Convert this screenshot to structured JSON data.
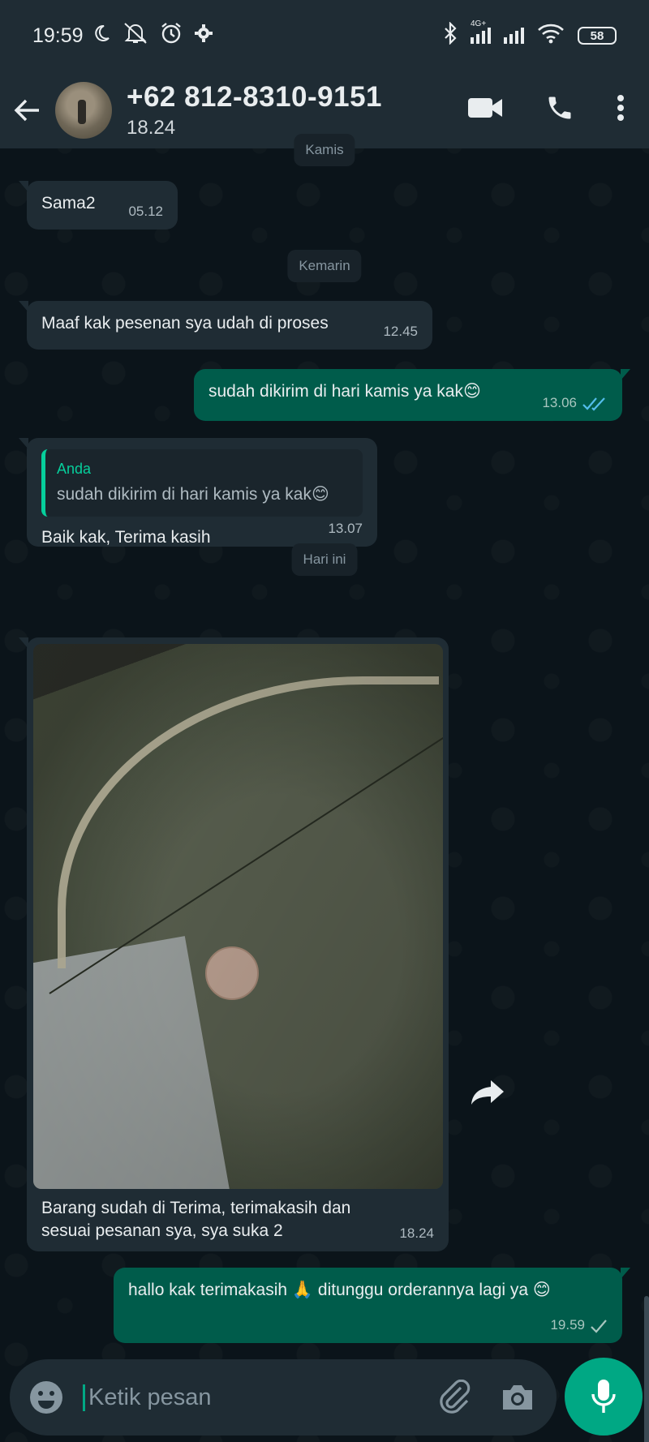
{
  "status": {
    "time": "19:59",
    "network": "4G+",
    "battery": "58"
  },
  "header": {
    "contact_name": "+62 812-8310-9151",
    "subtitle": "18.24"
  },
  "chat": {
    "dates": [
      "Kamis",
      "Kemarin",
      "Hari ini"
    ],
    "messages": [
      {
        "text": "Sama2",
        "time": "05.12"
      },
      {
        "text": "Maaf kak pesenan sya udah di proses",
        "time": "12.45"
      },
      {
        "text": "sudah dikirim di hari kamis ya kak😊",
        "time": "13.06"
      },
      {
        "quote_name": "Anda",
        "quote_text": "sudah dikirim di hari kamis ya kak😊",
        "text": "Baik kak, Terima kasih",
        "time": "13.07"
      },
      {
        "caption": "Barang sudah di Terima, terimakasih dan sesuai pesanan sya, sya suka 2",
        "time": "18.24"
      },
      {
        "text": "hallo kak terimakasih 🙏 ditunggu orderannya lagi ya 😊",
        "time": "19.59"
      }
    ]
  },
  "input": {
    "placeholder": "Ketik pesan"
  },
  "colors": {
    "incoming_bubble": "#1f2c34",
    "outgoing_bubble": "#005c4b",
    "accent": "#00a884",
    "read_ticks": "#53bdeb"
  }
}
